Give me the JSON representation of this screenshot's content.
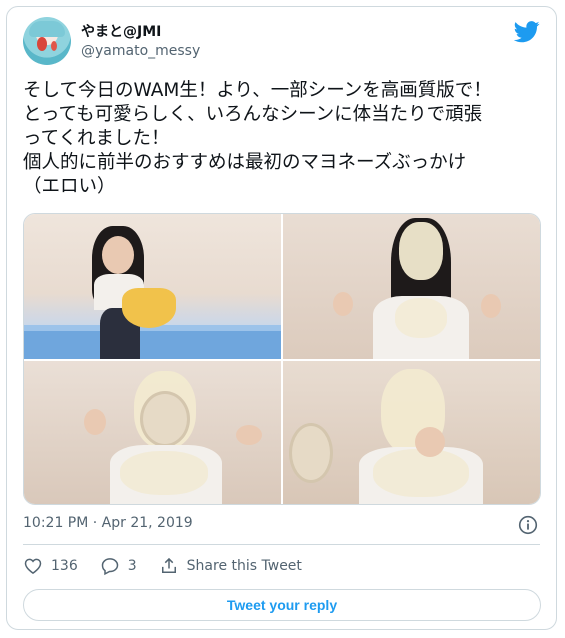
{
  "author": {
    "display_name": "やまと@JMI",
    "handle": "@yamato_messy"
  },
  "tweet": {
    "text": "そして今日のWAM生！より、一部シーンを高画質版で！\nとっても可愛らしく、いろんなシーンに体当たりで頑張\nってくれました！\n個人的に前半のおすすめは最初のマヨネーズぶっかけ\n（エロい）",
    "timestamp": "10:21 PM · Apr 21, 2019"
  },
  "actions": {
    "likes": "136",
    "replies": "3",
    "share_label": "Share this Tweet"
  },
  "reply_button": {
    "label": "Tweet your reply"
  },
  "icons": {
    "brand": "twitter-bird-icon",
    "info": "info-icon",
    "like": "heart-icon",
    "reply": "speech-bubble-icon",
    "share": "share-icon"
  },
  "colors": {
    "accent": "#1d9bf0",
    "secondary_text": "#536471",
    "border": "#cfd9de"
  }
}
